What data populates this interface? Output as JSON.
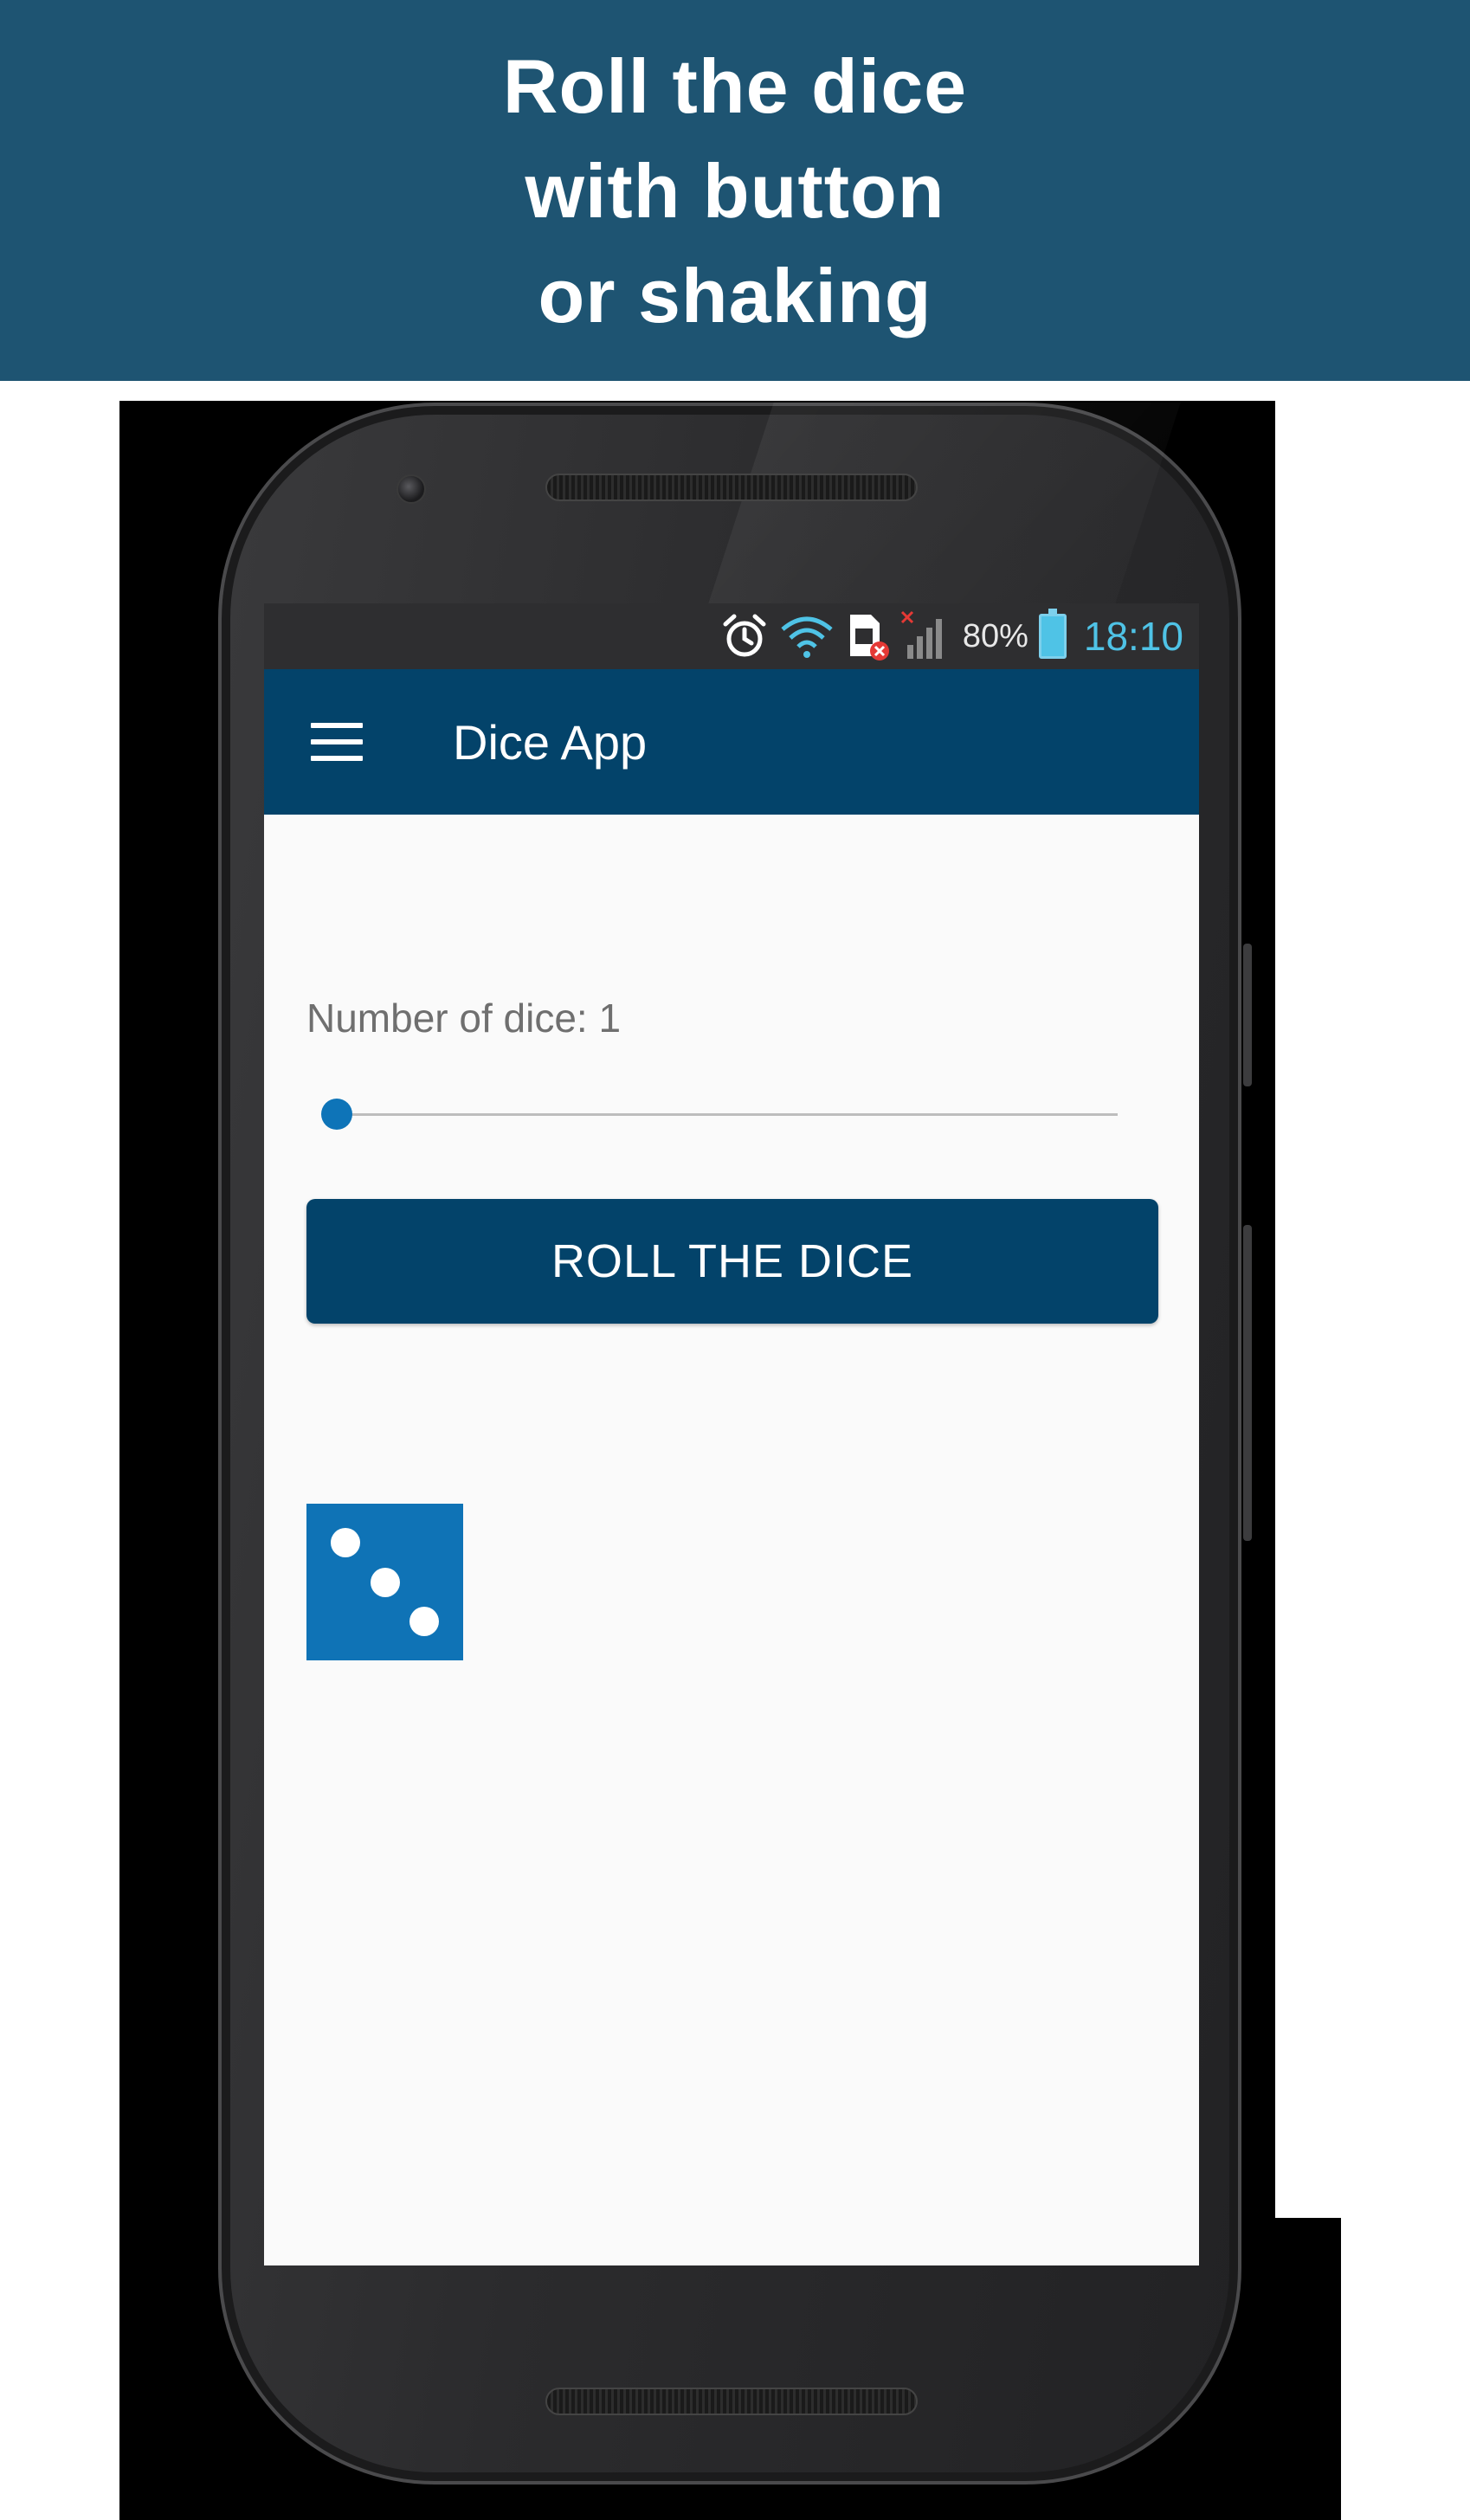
{
  "banner": {
    "lines": [
      "Roll the dice",
      "with button",
      "or shaking"
    ]
  },
  "status_bar": {
    "icons": [
      "alarm-icon",
      "wifi-icon",
      "sim-card-error-icon",
      "signal-no-service-icon"
    ],
    "battery_percent": "80%",
    "time": "18:10",
    "colors": {
      "time": "#4fc3e6",
      "battery": "#4fc3e6"
    }
  },
  "app_bar": {
    "menu_icon": "hamburger-menu-icon",
    "title": "Dice App",
    "color": "#03436a"
  },
  "controls": {
    "dice_label": "Number of dice: 1",
    "slider": {
      "value": 1,
      "min": 1,
      "max": 10,
      "accent": "#0e74b8"
    },
    "roll_button_label": "ROLL THE DICE"
  },
  "dice": [
    {
      "value": 3,
      "color": "#0f73b6"
    }
  ]
}
